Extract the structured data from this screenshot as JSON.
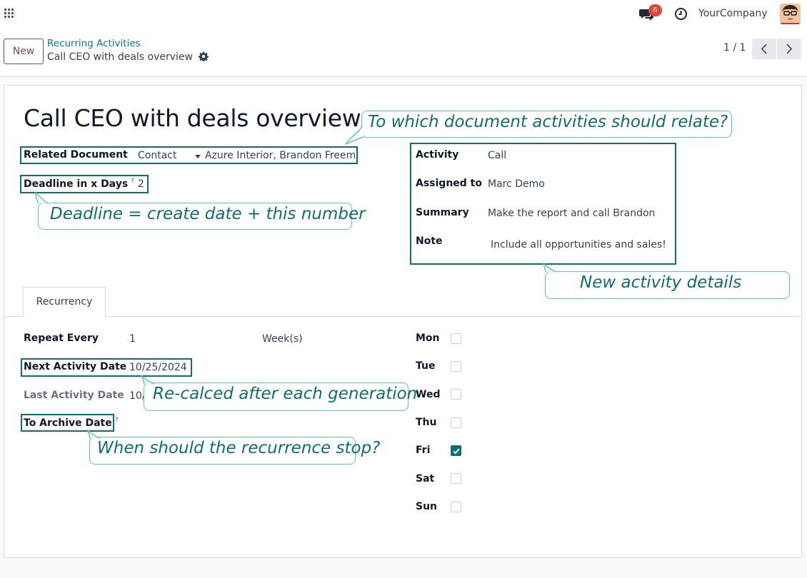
{
  "navbar": {
    "apps_icon": "apps-grid-icon",
    "chat_icon": "chat-icon",
    "message_count": "6",
    "clock_icon": "clock-icon",
    "company": "YourCompany",
    "accent": "#714b67"
  },
  "control": {
    "new_label": "New",
    "breadcrumb_parent": "Recurring Activities",
    "breadcrumb_current": "Call CEO with deals overview",
    "pager": "1 / 1"
  },
  "form": {
    "title": "Call CEO with deals overview",
    "related_document_label": "Related Document",
    "related_model": "Contact",
    "related_record": "Azure Interior, Brandon Freem",
    "deadline_label": "Deadline in x Days",
    "deadline_help": "?",
    "deadline_value": "2",
    "activity_label": "Activity",
    "activity_value": "Call",
    "assigned_label": "Assigned to",
    "assigned_value": "Marc Demo",
    "summary_label": "Summary",
    "summary_value": "Make the report and call Brandon",
    "note_label": "Note",
    "note_value": "Include all opportunities and sales!"
  },
  "tabs": [
    {
      "label": "Recurrency",
      "active": true
    }
  ],
  "recurrency": {
    "repeat_label": "Repeat Every",
    "repeat_value": "1",
    "repeat_unit": "Week(s)",
    "next_label": "Next Activity Date",
    "next_value": "10/25/2024",
    "last_label": "Last Activity Date",
    "last_value": "10/",
    "archive_label": "To Archive Date",
    "archive_help": "?",
    "days": [
      {
        "label": "Mon",
        "checked": false
      },
      {
        "label": "Tue",
        "checked": false
      },
      {
        "label": "Wed",
        "checked": false
      },
      {
        "label": "Thu",
        "checked": false
      },
      {
        "label": "Fri",
        "checked": true
      },
      {
        "label": "Sat",
        "checked": false
      },
      {
        "label": "Sun",
        "checked": false
      }
    ]
  },
  "callouts": {
    "relate": "To which document activities should relate?",
    "deadline": "Deadline = create date + this number",
    "details": "New activity details",
    "recalc": "Re-calced after each generation",
    "stop": "When should the recurrence stop?"
  },
  "colors": {
    "brand": "#714b67",
    "teal": "#017e84",
    "highlight_border": "#0f6e71",
    "callout_border": "#5ec9a6",
    "badge": "#e3413a"
  }
}
